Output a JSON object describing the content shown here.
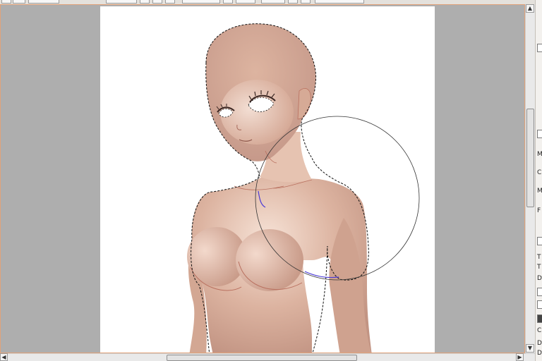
{
  "toolbar": {
    "button_count": 10
  },
  "canvas": {
    "background": "#ffffff",
    "margin_color": "#aeaeae"
  },
  "frame": {
    "border_color": "#e0a27a"
  },
  "brush": {
    "cursor": "circle"
  },
  "selection": {
    "style": "marching-ants"
  },
  "scrollbars": {
    "up_arrow": "▲",
    "down_arrow": "▼",
    "left_arrow": "◀",
    "right_arrow": "▶"
  },
  "side_panel": {
    "labels": [
      "M",
      "C",
      "M",
      "F",
      "T",
      "T",
      "D",
      "C",
      "D",
      "D"
    ]
  },
  "colors": {
    "skin": "#d9ad9a",
    "skin_light": "#f3ddd0",
    "skin_shadow": "#b98b78",
    "line": "#b0635a",
    "accent": "#e0a27a"
  }
}
